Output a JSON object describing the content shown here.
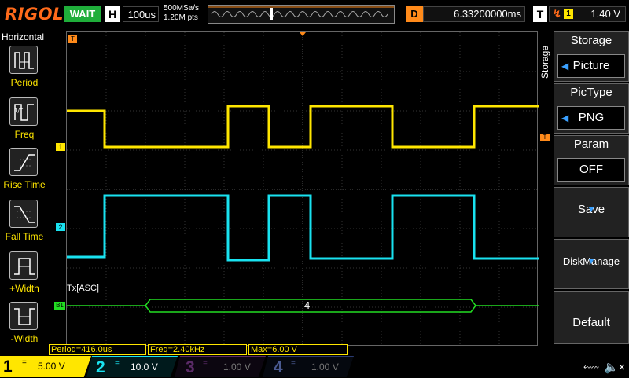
{
  "brand": "RIGOL",
  "colors": {
    "ch1": "#ffe600",
    "ch2": "#19e2f0",
    "ch3": "#b83cc8",
    "ch4": "#3a5ec8",
    "bus": "#22dd22",
    "accent": "#ff8a1a"
  },
  "top": {
    "run_state": "WAIT",
    "h_badge": "H",
    "timebase": "100us",
    "sample_rate": "500MSa/s",
    "mem_depth": "1.20M pts",
    "d_badge": "D",
    "delay": "6.33200000ms",
    "t_badge": "T",
    "trigger_source": "1",
    "trigger_level": "1.40 V"
  },
  "leftmenu": {
    "title": "Horizontal",
    "items": [
      {
        "label": "Period",
        "icon": "period-icon"
      },
      {
        "label": "Freq",
        "icon": "freq-icon"
      },
      {
        "label": "Rise Time",
        "icon": "rise-time-icon"
      },
      {
        "label": "Fall Time",
        "icon": "fall-time-icon"
      },
      {
        "label": "+Width",
        "icon": "pos-width-icon"
      },
      {
        "label": "-Width",
        "icon": "neg-width-icon"
      }
    ]
  },
  "grid": {
    "ch1_marker": "1",
    "ch2_marker": "2",
    "bus_marker": "B1",
    "trigger_marker": "T",
    "bus_label": "Tx[ASC]",
    "bus_value": "4"
  },
  "rightmenu": {
    "side_label": "Storage",
    "storage_title": "Storage",
    "storage_value": "Picture",
    "pictype_title": "PicType",
    "pictype_value": "PNG",
    "param_title": "Param",
    "param_value": "OFF",
    "save": "Save",
    "diskmanage": "DiskManage",
    "default": "Default"
  },
  "measurements": {
    "period": "Period=416.0us",
    "freq": "Freq=2.40kHz",
    "max": "Max=6.00 V"
  },
  "channels": [
    {
      "num": "1",
      "coupling": "=",
      "scale": "5.00 V"
    },
    {
      "num": "2",
      "coupling": "=",
      "scale": "10.0 V"
    },
    {
      "num": "3",
      "coupling": "=",
      "scale": "1.00 V"
    },
    {
      "num": "4",
      "coupling": "=",
      "scale": "1.00 V"
    }
  ]
}
